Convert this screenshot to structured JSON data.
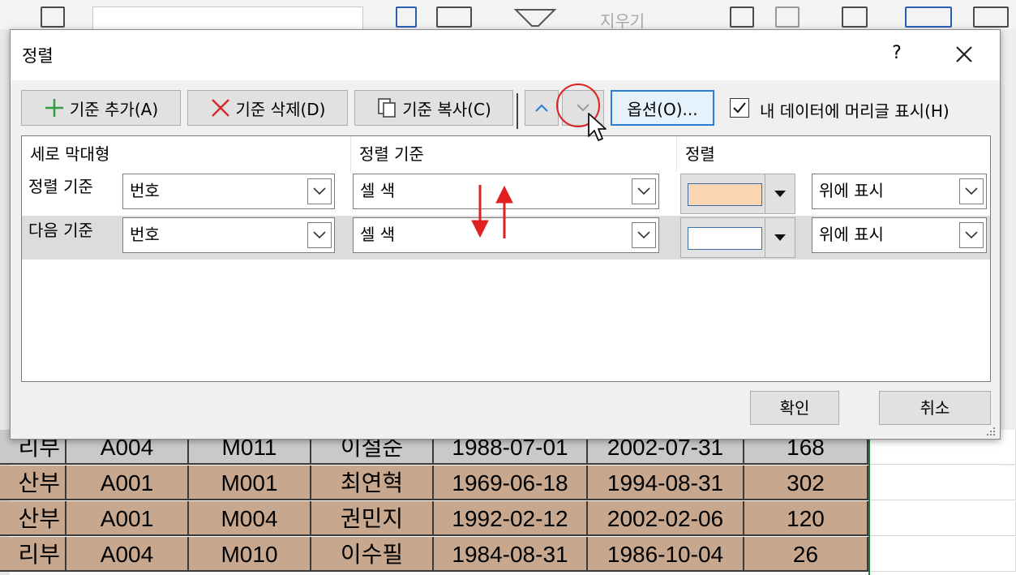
{
  "ribbon": {
    "clear_label": "지우기"
  },
  "dialog": {
    "title": "정렬",
    "help_label": "?",
    "toolbar": {
      "add_level": "기준 추가(A)",
      "delete_level": "기준 삭제(D)",
      "copy_level": "기준 복사(C)",
      "options": "옵션(O)...",
      "header_checkbox": "내 데이터에 머리글 표시(H)",
      "header_checked": true
    },
    "columns": {
      "column": "세로 막대형",
      "sort_on": "정렬 기준",
      "order": "정렬"
    },
    "levels": [
      {
        "label": "정렬 기준",
        "column": "번호",
        "sort_on": "셀 색",
        "color": "#fcd5b4",
        "position": "위에 표시"
      },
      {
        "label": "다음 기준",
        "column": "번호",
        "sort_on": "셀 색",
        "color": "#ffffff",
        "position": "위에 표시"
      }
    ],
    "ok": "확인",
    "cancel": "취소"
  },
  "sheet": {
    "rows": [
      {
        "dept": "리부",
        "code": "A004",
        "emp": "M011",
        "name": "이철순",
        "birth": "1988-07-01",
        "hire": "2002-07-31",
        "value": "168",
        "fill": "#c9c9c9"
      },
      {
        "dept": "산부",
        "code": "A001",
        "emp": "M001",
        "name": "최연혁",
        "birth": "1969-06-18",
        "hire": "1994-08-31",
        "value": "302",
        "fill": "#c8a78f"
      },
      {
        "dept": "산부",
        "code": "A001",
        "emp": "M004",
        "name": "권민지",
        "birth": "1992-02-12",
        "hire": "2002-02-06",
        "value": "120",
        "fill": "#c8a78f"
      },
      {
        "dept": "리부",
        "code": "A004",
        "emp": "M010",
        "name": "이수필",
        "birth": "1984-08-31",
        "hire": "1986-10-04",
        "value": "26",
        "fill": "#c8a78f"
      }
    ]
  }
}
